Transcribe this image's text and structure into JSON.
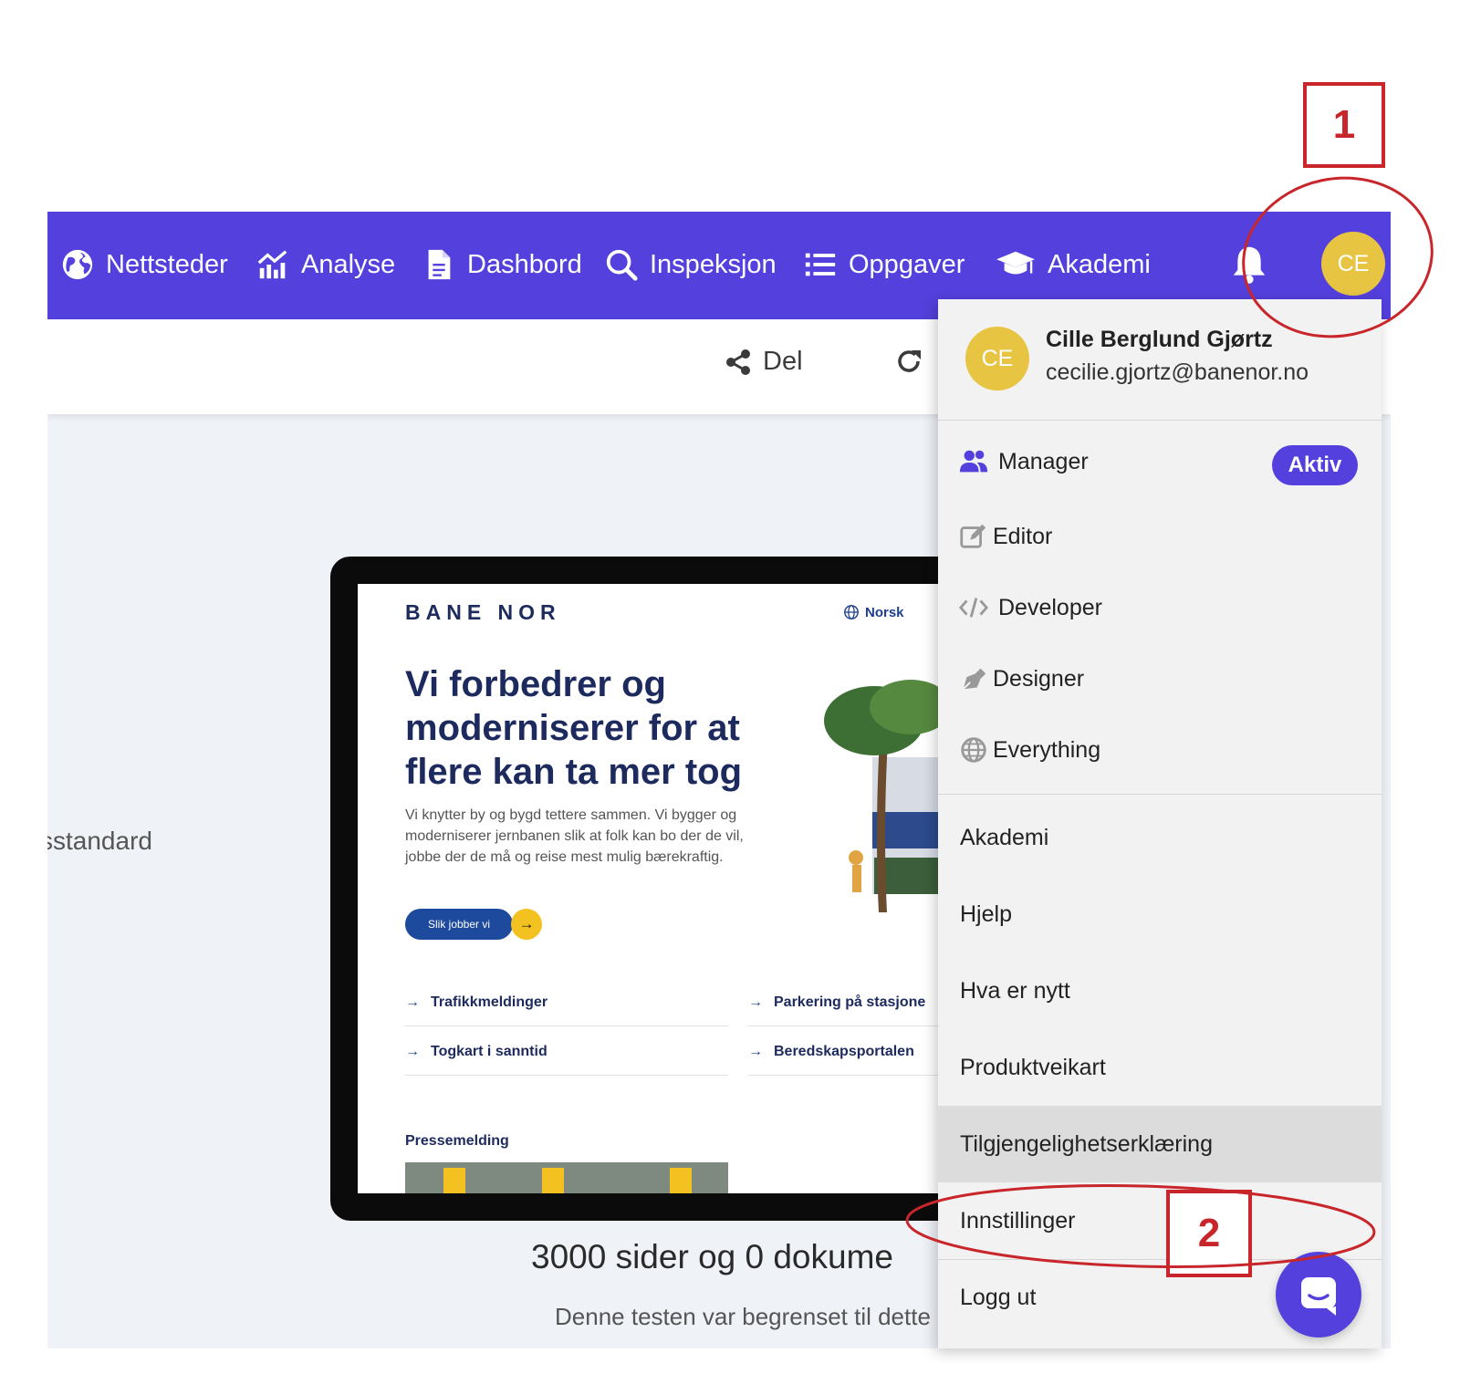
{
  "nav": {
    "items": [
      {
        "label": "Nettsteder",
        "icon": "globe-icon"
      },
      {
        "label": "Analyse",
        "icon": "analytics-chart-icon"
      },
      {
        "label": "Dashbord",
        "icon": "document-icon"
      },
      {
        "label": "Inspeksjon",
        "icon": "search-icon"
      },
      {
        "label": "Oppgaver",
        "icon": "list-icon"
      },
      {
        "label": "Akademi",
        "icon": "graduation-cap-icon"
      }
    ],
    "bell_icon": "bell-icon",
    "avatar_initials": "CE"
  },
  "toolbar": {
    "share_label": "Del",
    "share_icon": "share-icon",
    "refresh_icon": "refresh-icon"
  },
  "main": {
    "side_text": "sstandard",
    "summary": "3000 sider og 0 dokume",
    "summary_sub": "Denne testen var begrenset til dette antall sider"
  },
  "preview": {
    "logo": "BANE NOR",
    "language": "Norsk",
    "heading": "Vi forbedrer og moderniserer for at flere kan ta mer tog",
    "intro": "Vi knytter by og bygd tettere sammen. Vi bygger og moderniserer jernbanen slik at folk kan bo der de vil, jobbe der de må og reise mest mulig bærekraftig.",
    "button_label": "Slik jobber vi",
    "links": [
      "Trafikkmeldinger",
      "Parkering på stasjone",
      "Togkart i sanntid",
      "Beredskapsportalen"
    ],
    "press_label": "Pressemelding"
  },
  "menu": {
    "user": {
      "initials": "CE",
      "name": "Cille Berglund Gjørtz",
      "email": "cecilie.gjortz@banenor.no"
    },
    "roles": [
      {
        "label": "Manager",
        "icon": "users-icon",
        "badge": "Aktiv"
      },
      {
        "label": "Editor",
        "icon": "edit-icon"
      },
      {
        "label": "Developer",
        "icon": "code-icon"
      },
      {
        "label": "Designer",
        "icon": "pen-nib-icon"
      },
      {
        "label": "Everything",
        "icon": "globe-icon"
      }
    ],
    "links": [
      "Akademi",
      "Hjelp",
      "Hva er nytt",
      "Produktveikart",
      "Tilgjengelighetserklæring",
      "Innstillinger",
      "Logg ut"
    ],
    "highlighted": "Tilgjengelighetserklæring"
  },
  "chat_icon": "chat-bubble-icon",
  "annotations": {
    "marker_1": "1",
    "marker_2": "2",
    "color": "#c8262a"
  },
  "colors": {
    "brand": "#5340dd",
    "avatar": "#e8c443",
    "bane_nor_navy": "#1d2a5e",
    "bane_nor_yellow": "#f3c221"
  }
}
